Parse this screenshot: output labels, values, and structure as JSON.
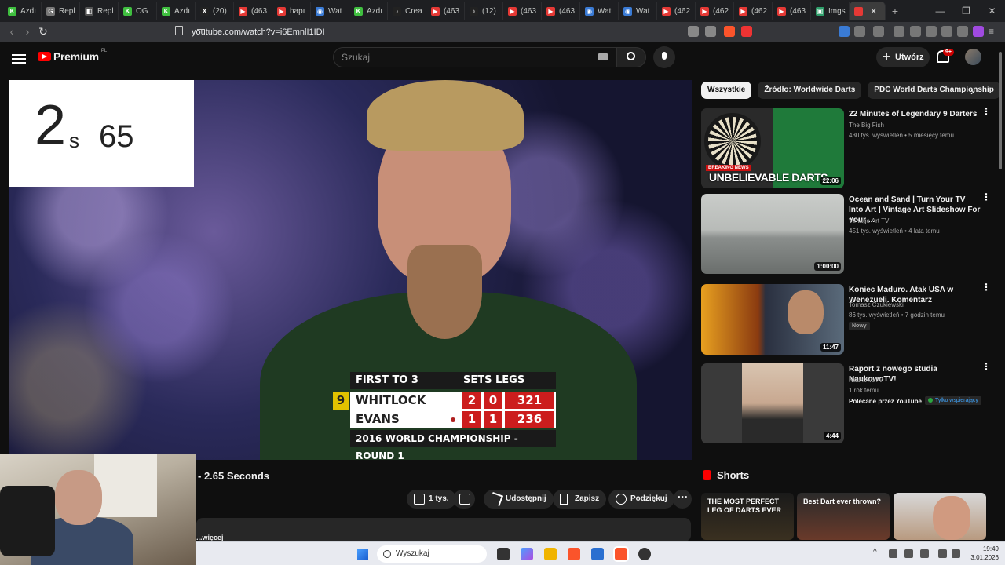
{
  "browser": {
    "tabs": [
      {
        "label": "Azdı",
        "color": "#3fbf3f",
        "glyph": "K"
      },
      {
        "label": "Repl",
        "color": "#777777",
        "glyph": "G"
      },
      {
        "label": "Repl",
        "color": "#555555",
        "glyph": "◧"
      },
      {
        "label": "OG",
        "color": "#3fbf3f",
        "glyph": "K"
      },
      {
        "label": "Azdı",
        "color": "#3fbf3f",
        "glyph": "K"
      },
      {
        "label": "(20)",
        "color": "#222222",
        "glyph": "X"
      },
      {
        "label": "(463",
        "color": "#e53935",
        "glyph": "▶"
      },
      {
        "label": "hapı",
        "color": "#e53935",
        "glyph": "▶"
      },
      {
        "label": "Wat",
        "color": "#3a7bd5",
        "glyph": "◉"
      },
      {
        "label": "Azdı",
        "color": "#3fbf3f",
        "glyph": "K"
      },
      {
        "label": "Crea",
        "color": "#222222",
        "glyph": "♪"
      },
      {
        "label": "(463",
        "color": "#e53935",
        "glyph": "▶"
      },
      {
        "label": "(12)",
        "color": "#222222",
        "glyph": "♪"
      },
      {
        "label": "(463",
        "color": "#e53935",
        "glyph": "▶"
      },
      {
        "label": "(463",
        "color": "#e53935",
        "glyph": "▶"
      },
      {
        "label": "Wat",
        "color": "#3a7bd5",
        "glyph": "◉"
      },
      {
        "label": "Wat",
        "color": "#3a7bd5",
        "glyph": "◉"
      },
      {
        "label": "(462",
        "color": "#e53935",
        "glyph": "▶"
      },
      {
        "label": "(462",
        "color": "#e53935",
        "glyph": "▶"
      },
      {
        "label": "(462",
        "color": "#e53935",
        "glyph": "▶"
      },
      {
        "label": "(463",
        "color": "#e53935",
        "glyph": "▶"
      },
      {
        "label": "Imgs",
        "color": "#2e9e6a",
        "glyph": "▣"
      }
    ],
    "url": "youtube.com/watch?v=i6EmnlI1IDI",
    "window_controls": [
      "—",
      "❐",
      "✕"
    ]
  },
  "youtube": {
    "logo_text": "Premium",
    "logo_region": "PL",
    "search_placeholder": "Szukaj",
    "create_label": "Utwórz",
    "notif_count": "9+"
  },
  "overlay": {
    "big_number": "2",
    "small_s": "s",
    "hundredths": "65"
  },
  "scoreboard": {
    "header": "FIRST TO 3",
    "sets_legs": "SETS  LEGS",
    "players": [
      {
        "name": "WHITLOCK",
        "sets": "2",
        "legs": "0",
        "score": "321"
      },
      {
        "name": "EVANS",
        "sets": "1",
        "legs": "1",
        "score": "236"
      }
    ],
    "throw_indicator": "9",
    "footer": "2016 WORLD CHAMPIONSHIP - ROUND 1"
  },
  "video": {
    "title": "- 2.65 Seconds",
    "actions": {
      "like": "1 tys.",
      "share": "Udostępnij",
      "save": "Zapisz",
      "thanks": "Podziękuj"
    },
    "more_text": "...więcej"
  },
  "sidebar": {
    "chips": [
      "Wszystkie",
      "Źródło: Worldwide Darts",
      "PDC World Darts Championship"
    ],
    "recommendations": [
      {
        "title": "22 Minutes of Legendary 9 Darters",
        "channel": "The Big Fish",
        "meta": "430 tys. wyświetleń • 5 miesięcy temu",
        "duration": "22:06",
        "thumb_caption": "UNBELIEVABLE DARTS",
        "thumb_badge": "BREAKING NEWS"
      },
      {
        "title": "Ocean and Sand | Turn Your TV Into Art | Vintage Art Slideshow For Your ...",
        "channel": "Vintage Art TV",
        "meta": "451 tys. wyświetleń • 4 lata temu",
        "duration": "1:00:00"
      },
      {
        "title": "Koniec Maduro. Atak USA w Wenezueli. Komentarz",
        "channel": "Tomasz Czukiewski",
        "meta": "86 tys. wyświetleń • 7 godzin temu",
        "duration": "11:47",
        "badge": "Nowy"
      },
      {
        "title": "Raport z nowego studia NaukowoTV!",
        "channel": "NaukowoTV",
        "meta": "1 rok temu",
        "duration": "4:44",
        "recommended": "Polecane przez YouTube",
        "support": "Tylko wspierający"
      }
    ],
    "shorts_header": "Shorts",
    "shorts": [
      {
        "title": "THE MOST PERFECT LEG OF DARTS EVER"
      },
      {
        "title": "Best Dart ever thrown?"
      },
      {
        "title": ""
      }
    ]
  },
  "taskbar": {
    "search_placeholder": "Wyszukaj",
    "time": "19:49",
    "date": "3.01.2026"
  }
}
